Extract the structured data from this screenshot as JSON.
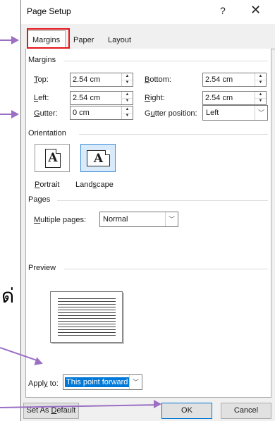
{
  "window": {
    "title": "Page Setup",
    "help_glyph": "?",
    "close_glyph": "✕"
  },
  "tabs": [
    {
      "label": "Margins",
      "active": true
    },
    {
      "label": "Paper",
      "active": false
    },
    {
      "label": "Layout",
      "active": false
    }
  ],
  "margins": {
    "group_label": "Margins",
    "top": {
      "label_pre": "",
      "label_key": "T",
      "label_post": "op:",
      "value": "2.54 cm"
    },
    "bottom": {
      "label_pre": "",
      "label_key": "B",
      "label_post": "ottom:",
      "value": "2.54 cm"
    },
    "left": {
      "label_pre": "",
      "label_key": "L",
      "label_post": "eft:",
      "value": "2.54 cm"
    },
    "right": {
      "label_pre": "",
      "label_key": "R",
      "label_post": "ight:",
      "value": "2.54 cm"
    },
    "gutter": {
      "label_pre": "",
      "label_key": "G",
      "label_post": "utter:",
      "value": "0 cm"
    },
    "gutter_position": {
      "label_pre": "G",
      "label_key": "u",
      "label_post": "tter position:",
      "value": "Left"
    }
  },
  "orientation": {
    "group_label": "Orientation",
    "portrait": {
      "label_pre": "",
      "label_key": "P",
      "label_post": "ortrait",
      "glyph": "A"
    },
    "landscape": {
      "label_pre": "Land",
      "label_key": "s",
      "label_post": "cape",
      "glyph": "A",
      "selected": true
    }
  },
  "pages": {
    "group_label": "Pages",
    "multiple": {
      "label_pre": "",
      "label_key": "M",
      "label_post": "ultiple pages:",
      "value": "Normal"
    }
  },
  "preview": {
    "group_label": "Preview"
  },
  "apply": {
    "label_pre": "Appl",
    "label_key": "y",
    "label_post": " to:",
    "value": "This point forward"
  },
  "buttons": {
    "set_default_pre": "Set As ",
    "set_default_key": "D",
    "set_default_post": "efault",
    "ok": "OK",
    "cancel": "Cancel"
  },
  "annotation": {
    "thai_glyph": "ด่"
  },
  "colors": {
    "highlight": "#e3141b",
    "arrow": "#9a6fc4",
    "selection": "#0078d7"
  }
}
